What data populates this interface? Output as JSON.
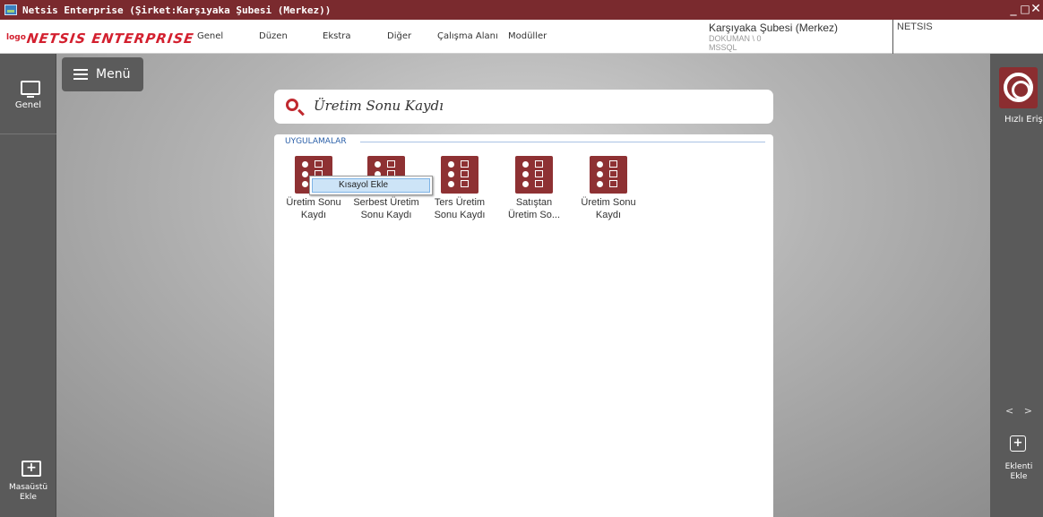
{
  "window": {
    "title": "Netsis Enterprise (Şirket:Karşıyaka Şubesi (Merkez))",
    "minimize": "_",
    "restore": "□",
    "close": "✕"
  },
  "logo": {
    "small": "logo",
    "main": "NETSIS ENTERPRISE"
  },
  "menubar": {
    "items": [
      "Genel",
      "Düzen",
      "Ekstra",
      "Diğer",
      "Çalışma Alanı",
      "Modüller"
    ]
  },
  "company": {
    "name": "Karşıyaka Şubesi (Merkez)",
    "database": "DOKUMAN \\ 0",
    "server": "MSSQL"
  },
  "user": {
    "name": "NETSIS"
  },
  "left_sidebar": {
    "genel_label": "Genel",
    "masaustu_label_line1": "Masaüstü",
    "masaustu_label_line2": "Ekle"
  },
  "menu_button": {
    "label": "Menü"
  },
  "search": {
    "value": "Üretim Sonu Kaydı"
  },
  "results": {
    "section_title": "UYGULAMALAR",
    "apps": [
      {
        "line1": "Üretim Sonu",
        "line2": "Kaydı"
      },
      {
        "line1": "Serbest Üretim",
        "line2": "Sonu Kaydı"
      },
      {
        "line1": "Ters Üretim",
        "line2": "Sonu Kaydı"
      },
      {
        "line1": "Satıştan",
        "line2": "Üretim So..."
      },
      {
        "line1": "Üretim Sonu",
        "line2": "Kaydı"
      }
    ]
  },
  "context_menu": {
    "item": "Kısayol Ekle"
  },
  "right_sidebar": {
    "hizli_label": "Hızlı Erişim",
    "prev": "<",
    "next": ">",
    "eklenti_line1": "Eklenti",
    "eklenti_line2": "Ekle"
  },
  "colors": {
    "brand": "#7a2a2e",
    "app_icon": "#8e3133",
    "logo": "#d3202f",
    "section": "#2a5fa8"
  }
}
